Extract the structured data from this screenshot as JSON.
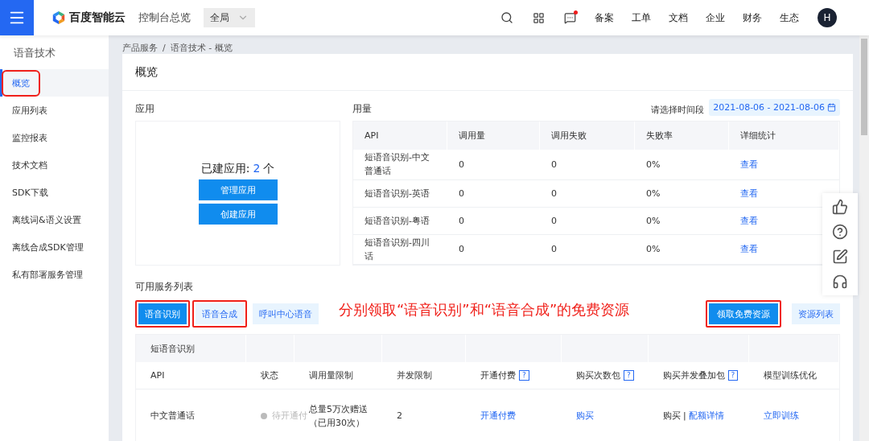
{
  "topbar": {
    "logo_text": "百度智能云",
    "title": "控制台总览",
    "region": "全局",
    "nav": [
      "备案",
      "工单",
      "文档",
      "企业",
      "财务",
      "生态"
    ],
    "message_unread": true,
    "avatar": "H"
  },
  "sidebar": {
    "title": "语音技术",
    "items": [
      {
        "label": "概览",
        "selected": true,
        "annotated": true
      },
      {
        "label": "应用列表",
        "selected": false,
        "annotated": false
      },
      {
        "label": "监控报表",
        "selected": false,
        "annotated": false
      },
      {
        "label": "技术文档",
        "selected": false,
        "annotated": false
      },
      {
        "label": "SDK下载",
        "selected": false,
        "annotated": false
      },
      {
        "label": "离线词&语义设置",
        "selected": false,
        "annotated": false
      },
      {
        "label": "离线合成SDK管理",
        "selected": false,
        "annotated": false
      },
      {
        "label": "私有部署服务管理",
        "selected": false,
        "annotated": false
      }
    ]
  },
  "breadcrumb": {
    "items": [
      "产品服务",
      "语音技术 - 概览"
    ],
    "separator": "/"
  },
  "page_title": "概览",
  "apps": {
    "title": "应用",
    "count_label": "已建应用:",
    "count": "2",
    "count_unit": "个",
    "buttons": [
      "管理应用",
      "创建应用"
    ]
  },
  "usage": {
    "title": "用量",
    "date_label": "请选择时间段",
    "date_range": "2021-08-06 - 2021-08-06",
    "columns": [
      "API",
      "调用量",
      "调用失败",
      "失败率",
      "详细统计"
    ],
    "rows": [
      {
        "api": "短语音识别-中文普通话",
        "calls": "0",
        "failures": "0",
        "failure_rate": "0%",
        "detail": "查看"
      },
      {
        "api": "短语音识别-英语",
        "calls": "0",
        "failures": "0",
        "failure_rate": "0%",
        "detail": "查看"
      },
      {
        "api": "短语音识别-粤语",
        "calls": "0",
        "failures": "0",
        "failure_rate": "0%",
        "detail": "查看"
      },
      {
        "api": "短语音识别-四川话",
        "calls": "0",
        "failures": "0",
        "failure_rate": "0%",
        "detail": "查看"
      }
    ]
  },
  "services": {
    "title": "可用服务列表",
    "tabs": [
      {
        "label": "语音识别",
        "selected": true,
        "annotated": true
      },
      {
        "label": "语音合成",
        "selected": false,
        "annotated": true
      },
      {
        "label": "呼叫中心语音",
        "selected": false,
        "annotated": false
      }
    ],
    "claim_button": {
      "label": "领取免费资源",
      "annotated": true
    },
    "resource_list": "资源列表",
    "group": "短语音识别",
    "help_mark": "?",
    "columns": [
      {
        "label": "API",
        "help": false
      },
      {
        "label": "状态",
        "help": false
      },
      {
        "label": "调用量限制",
        "help": false
      },
      {
        "label": "并发限制",
        "help": false
      },
      {
        "label": "开通付费",
        "help": true
      },
      {
        "label": "购买次数包",
        "help": true
      },
      {
        "label": "购买并发叠加包",
        "help": true
      },
      {
        "label": "模型训练优化",
        "help": false
      }
    ],
    "rows": [
      {
        "api": "中文普通话",
        "status": "待开通付",
        "quota_lines": [
          "总量5万次赠送",
          "（已用30次）"
        ],
        "concurrency": "2",
        "pay": "开通付费",
        "buy": "购买",
        "stack_buy": "购买",
        "stack_sep": "|",
        "stack_detail": "配额详情",
        "train": "立即训练"
      }
    ]
  },
  "annotation": {
    "text": "分别领取“语音识别”和“语音合成”的免费资源"
  }
}
